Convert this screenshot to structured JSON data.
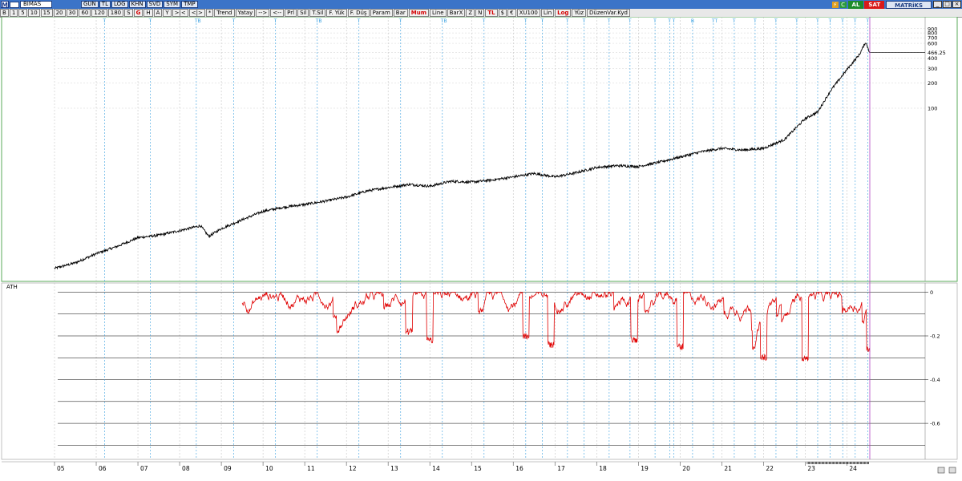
{
  "toolbar_top": {
    "symbol": "BIMAS",
    "buttons": [
      "GUN",
      "TL",
      "LOG",
      "KHN",
      "SVD",
      "SYM",
      "TMP"
    ],
    "al_label": "AL",
    "sat_label": "SAT",
    "brand": "MATRiKS"
  },
  "toolbar_second": {
    "buttons": [
      {
        "label": "B"
      },
      {
        "label": "1"
      },
      {
        "label": "5"
      },
      {
        "label": "10"
      },
      {
        "label": "15"
      },
      {
        "label": "20"
      },
      {
        "label": "30"
      },
      {
        "label": "60"
      },
      {
        "label": "120"
      },
      {
        "label": "180"
      },
      {
        "label": "S"
      },
      {
        "label": "G",
        "style": "red"
      },
      {
        "label": "H"
      },
      {
        "label": "A"
      },
      {
        "label": "Y"
      },
      {
        "label": ">|<"
      },
      {
        "label": "<|>"
      },
      {
        "label": "*"
      },
      {
        "label": "Trend"
      },
      {
        "label": "Yatay"
      },
      {
        "label": "-->"
      },
      {
        "label": "<--"
      },
      {
        "label": "Prl"
      },
      {
        "label": "Sil"
      },
      {
        "label": "T.Sil"
      },
      {
        "label": "F. Yük"
      },
      {
        "label": "F. Düş"
      },
      {
        "label": "Param"
      },
      {
        "label": "Bar"
      },
      {
        "label": "Mum",
        "style": "red"
      },
      {
        "label": "Line"
      },
      {
        "label": "BarX"
      },
      {
        "label": "Z"
      },
      {
        "label": "N"
      },
      {
        "label": "TL",
        "style": "red"
      },
      {
        "label": "$"
      },
      {
        "label": "€"
      },
      {
        "label": "XU100"
      },
      {
        "label": "Lin"
      },
      {
        "label": "Log",
        "style": "red"
      },
      {
        "label": "Yüz"
      },
      {
        "label": "DüzenVar.Kyd"
      }
    ]
  },
  "price_panel": {
    "last_price_label": "466.25",
    "scale": "log",
    "y_ticks": [
      "900",
      "800",
      "700",
      "600",
      "466.25",
      "400",
      "300",
      "200",
      "100"
    ],
    "t_markers": [
      "T",
      "T",
      "TB",
      "T",
      "T",
      "TB",
      "T",
      "T",
      "TB",
      "T",
      "T",
      "T",
      "T",
      "T",
      "T",
      "T",
      "T",
      "T",
      "T",
      "B",
      "TT",
      "T",
      "T",
      "T",
      "T",
      "T",
      "T",
      "T",
      "T",
      "T"
    ]
  },
  "indicator_panel": {
    "title": "ATH",
    "y_ticks": [
      "0",
      "-0.2",
      "-0.4",
      "-0.6"
    ],
    "ylim": [
      -0.75,
      0.02
    ],
    "line_color": "#e00000"
  },
  "x_axis": {
    "labels": [
      "05",
      "06",
      "07",
      "08",
      "09",
      "10",
      "11",
      "12",
      "13",
      "14",
      "15",
      "16",
      "17",
      "18",
      "19",
      "20",
      "21",
      "22",
      "23",
      "24"
    ]
  },
  "chart_data": [
    {
      "type": "line",
      "title": "BIMAS",
      "scale": "log",
      "x_start": "2005",
      "x_end": "2024",
      "series": [
        {
          "name": "BIMAS",
          "years": [
            2005.0,
            2005.5,
            2006.0,
            2006.5,
            2007.0,
            2007.5,
            2008.0,
            2008.5,
            2008.7,
            2009.0,
            2009.5,
            2010.0,
            2010.5,
            2011.0,
            2011.5,
            2012.0,
            2012.5,
            2013.0,
            2013.5,
            2014.0,
            2014.5,
            2015.0,
            2015.5,
            2016.0,
            2016.5,
            2017.0,
            2017.5,
            2018.0,
            2018.5,
            2019.0,
            2019.5,
            2020.0,
            2020.5,
            2021.0,
            2021.5,
            2022.0,
            2022.5,
            2023.0,
            2023.3,
            2023.6,
            2024.0,
            2024.3,
            2024.45,
            2024.55
          ],
          "values": [
            1.2,
            1.4,
            1.8,
            2.2,
            2.8,
            3.0,
            3.4,
            3.9,
            2.9,
            3.6,
            4.6,
            5.8,
            6.5,
            7.0,
            7.7,
            8.6,
            10.2,
            11.2,
            12.2,
            11.6,
            13.3,
            13.0,
            13.8,
            15.0,
            16.5,
            15.0,
            16.8,
            19.5,
            20.5,
            20.0,
            22.5,
            26.0,
            30.0,
            33.0,
            31.5,
            33.0,
            42.0,
            75.0,
            90.0,
            160.0,
            290.0,
            440.0,
            620.0,
            466.25
          ]
        }
      ]
    },
    {
      "type": "line",
      "title": "ATH",
      "ylim": [
        -0.75,
        0.02
      ],
      "series": [
        {
          "name": "ATH",
          "x_start": "2009.5",
          "x_end": "2024.55"
        }
      ]
    }
  ]
}
